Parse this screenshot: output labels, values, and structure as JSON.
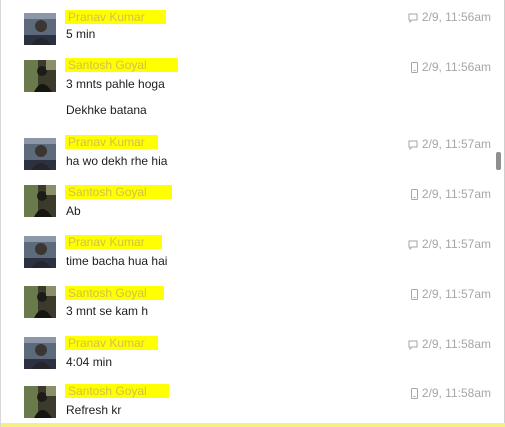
{
  "colors": {
    "highlight": "#ffff00",
    "meta_text": "#a6a6a6",
    "message_text": "#1d1d1d",
    "bottom_bar": "#f6ef86"
  },
  "messages": [
    {
      "sender": "Pranav Kumar",
      "texts": [
        "5 min"
      ],
      "time": "2/9, 11:56am",
      "device": "chat-bubble-icon"
    },
    {
      "sender": "Santosh Goyal",
      "texts": [
        "3 mnts pahle hoga",
        "Dekhke batana"
      ],
      "time": "2/9, 11:56am",
      "device": "mobile-phone-icon"
    },
    {
      "sender": "Pranav Kumar",
      "texts": [
        "ha wo dekh rhe hia"
      ],
      "time": "2/9, 11:57am",
      "device": "chat-bubble-icon"
    },
    {
      "sender": "Santosh Goyal",
      "texts": [
        "Ab"
      ],
      "time": "2/9, 11:57am",
      "device": "mobile-phone-icon"
    },
    {
      "sender": "Pranav Kumar",
      "texts": [
        "time bacha hua hai"
      ],
      "time": "2/9, 11:57am",
      "device": "chat-bubble-icon"
    },
    {
      "sender": "Santosh Goyal",
      "texts": [
        "3 mnt se kam h"
      ],
      "time": "2/9, 11:57am",
      "device": "mobile-phone-icon"
    },
    {
      "sender": "Pranav Kumar",
      "texts": [
        "4:04 min"
      ],
      "time": "2/9, 11:58am",
      "device": "chat-bubble-icon"
    },
    {
      "sender": "Santosh Goyal",
      "texts": [
        "Refresh kr"
      ],
      "time": "2/9, 11:58am",
      "device": "mobile-phone-icon"
    }
  ]
}
